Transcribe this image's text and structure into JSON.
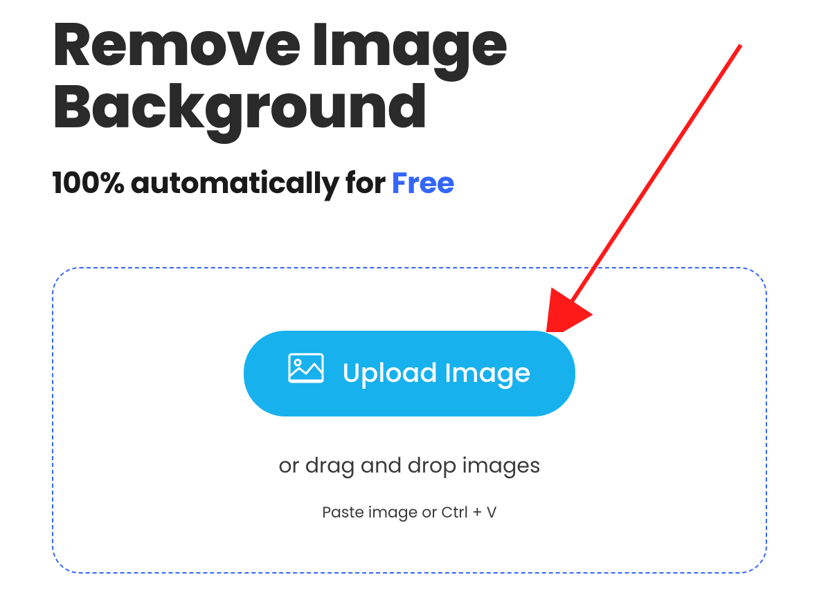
{
  "hero": {
    "title": "Remove Image Background",
    "subtitle_prefix": "100% automatically for ",
    "subtitle_highlight": "Free"
  },
  "dropzone": {
    "upload_button_label": "Upload Image",
    "drag_text": "or drag and drop images",
    "paste_text": "Paste image or Ctrl + V"
  },
  "colors": {
    "accent": "#3366ff",
    "button": "#17b1ee",
    "arrow": "#ff1a1a"
  }
}
